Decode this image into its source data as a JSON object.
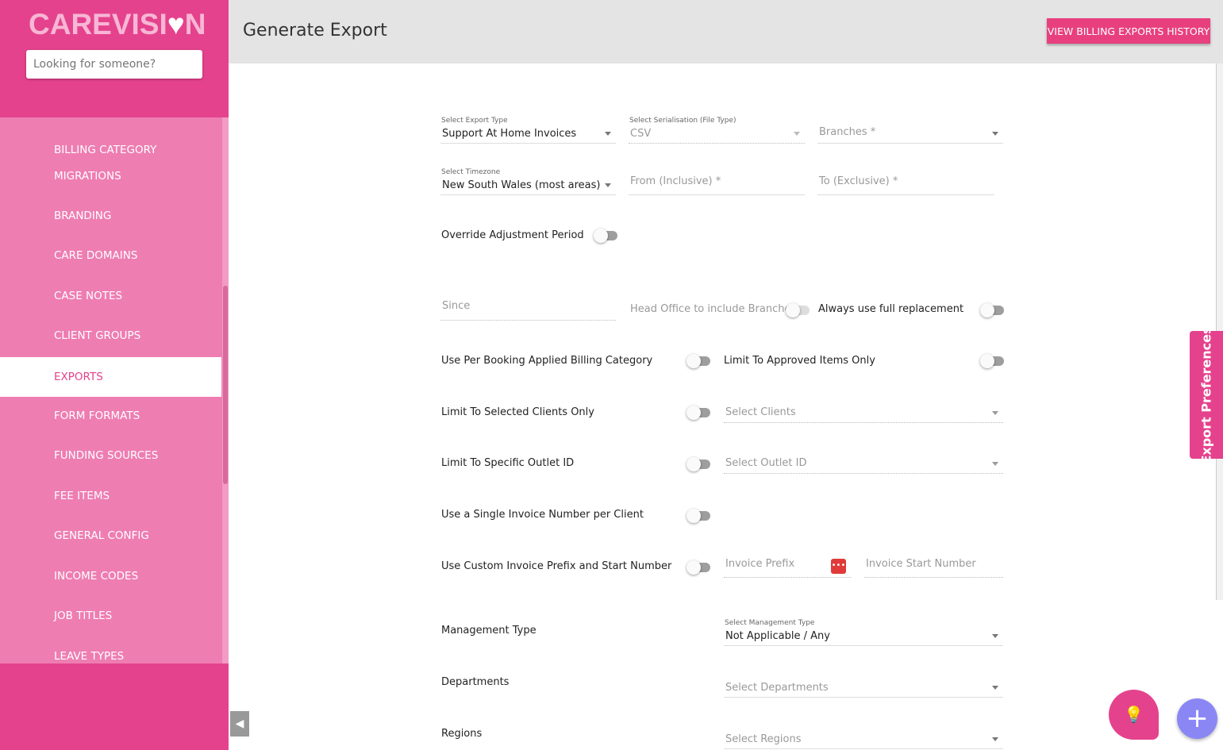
{
  "brand": {
    "logo": "CAREVISION",
    "accent": "#e5428d"
  },
  "search": {
    "placeholder": "Looking for someone?"
  },
  "sidebar": {
    "items": [
      {
        "label": "BILLING CATEGORY"
      },
      {
        "label": "MIGRATIONS"
      },
      {
        "label": "BRANDING"
      },
      {
        "label": "CARE DOMAINS"
      },
      {
        "label": "CASE NOTES"
      },
      {
        "label": "CLIENT GROUPS"
      },
      {
        "label": "EXPORTS",
        "active": true
      },
      {
        "label": "FORM FORMATS"
      },
      {
        "label": "FUNDING SOURCES"
      },
      {
        "label": "FEE ITEMS"
      },
      {
        "label": "GENERAL CONFIG"
      },
      {
        "label": "INCOME CODES"
      },
      {
        "label": "JOB TITLES"
      },
      {
        "label": "LEAVE TYPES"
      }
    ]
  },
  "header": {
    "title": "Generate Export",
    "history_button": "VIEW BILLING EXPORTS HISTORY"
  },
  "form": {
    "export_type": {
      "label": "Select Export Type",
      "value": "Support At Home Invoices"
    },
    "serialisation": {
      "label": "Select Serialisation (File Type)",
      "value": "CSV"
    },
    "branches": {
      "placeholder": "Branches *"
    },
    "timezone": {
      "label": "Select Timezone",
      "value": "New South Wales (most areas)"
    },
    "from": {
      "placeholder": "From (Inclusive) *"
    },
    "to": {
      "placeholder": "To (Exclusive) *"
    },
    "override_adjustment": {
      "label": "Override Adjustment Period",
      "on": false
    },
    "since": {
      "placeholder": "Since"
    },
    "head_office": {
      "label": "Head Office to include Branches",
      "on": false
    },
    "full_replacement": {
      "label": "Always use full replacement",
      "on": false
    },
    "per_booking": {
      "label": "Use Per Booking Applied Billing Category",
      "on": false
    },
    "approved_only": {
      "label": "Limit To Approved Items Only",
      "on": false
    },
    "selected_clients": {
      "label": "Limit To Selected Clients Only",
      "on": false,
      "placeholder": "Select Clients"
    },
    "outlet": {
      "label": "Limit To Specific Outlet ID",
      "on": false,
      "placeholder": "Select Outlet ID"
    },
    "single_invoice": {
      "label": "Use a Single Invoice Number per Client",
      "on": false
    },
    "custom_prefix": {
      "label": "Use Custom Invoice Prefix and Start Number",
      "on": false,
      "prefix_placeholder": "Invoice Prefix",
      "start_placeholder": "Invoice Start Number"
    },
    "management": {
      "label": "Management Type",
      "select_label": "Select Management Type",
      "value": "Not Applicable / Any"
    },
    "departments": {
      "label": "Departments",
      "placeholder": "Select Departments"
    },
    "regions": {
      "label": "Regions",
      "placeholder": "Select Regions"
    }
  },
  "prefs_tab": "Export Preferences",
  "icons": {
    "fab1": "lightbulb-icon",
    "fab2": "plus-icon",
    "dots": "password-dots-icon"
  }
}
